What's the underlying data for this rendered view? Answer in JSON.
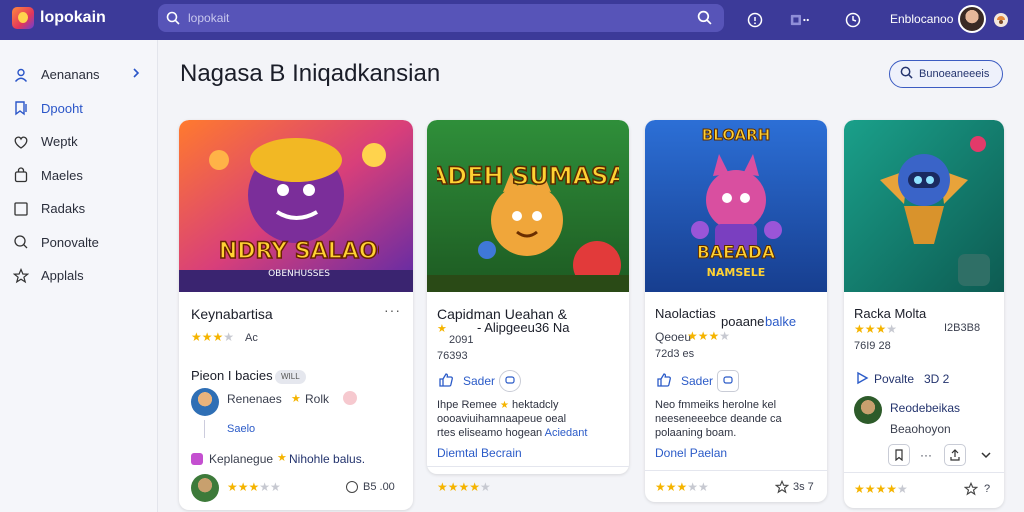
{
  "app": {
    "name": "lopokain"
  },
  "search": {
    "placeholder": "lopokait"
  },
  "user": {
    "name": "Enblocanoo"
  },
  "icons": [
    "search-icon",
    "help-icon",
    "apps-icon",
    "notifications-icon",
    "settings-icon"
  ],
  "sidebar": {
    "items": [
      {
        "label": "Aenanans",
        "icon": "person-icon"
      },
      {
        "label": "Dpooht",
        "icon": "bookmark-icon"
      },
      {
        "label": "Weptk",
        "icon": "heart-icon"
      },
      {
        "label": "Maeles",
        "icon": "bag-icon"
      },
      {
        "label": "Radaks",
        "icon": "square-icon"
      },
      {
        "label": "Ponovalte",
        "icon": "search-icon"
      },
      {
        "label": "Applals",
        "icon": "star-icon"
      }
    ]
  },
  "main": {
    "title": "Nagasa B Iniqadkansian",
    "filter_label": "Bunoeaneeeis"
  },
  "cards": [
    {
      "art_title": "AHNDRY SALAOON",
      "art_subtitle": "OBENHUSSES",
      "title": "Keynabartisa",
      "rating": 3,
      "rating_label": "Ac",
      "section_label": "Pieon I bacies",
      "section_badge": "WILL",
      "reviewer_name": "Renenaes",
      "reviewer_extra": "Rolk",
      "reviewer_sub": "Saelo",
      "tagline_a": "Keplanegue",
      "tagline_b": "Nihohle balus.",
      "footer_rating": 3,
      "footer_meta": "B5 .00"
    },
    {
      "art_title": "GADEH SUMASAN",
      "title": "Capidman Ueahan &",
      "subtitle": "- Alipgeeu36 Na",
      "rating": 2,
      "year_line_1": "2091",
      "year_line_2": "76393",
      "action_label": "Sader",
      "desc_1": "Ihpe Remee",
      "desc_1b": "hektadcly",
      "desc_2": "oooaviuihamnaapeue oeal",
      "desc_3": "rtes eliseamo hogean",
      "desc_3b": "Aciedant",
      "link": "Diemtal Becrain",
      "footer_rating": 4
    },
    {
      "art_title": "BLOARH",
      "art_sub_1": "BAEADA",
      "art_sub_2": "NAMSELE",
      "title": "Naolactias",
      "title_b": "poaane",
      "title_c": "balke",
      "subtitle": "Qeoeu",
      "rating": 3,
      "meta": "72d3 es",
      "action_label": "Sader",
      "desc_1": "Neo fmmeiks herolne kel",
      "desc_2": "neeseneeebce deande ca",
      "desc_3": "polaaning boam.",
      "link": "Donel Paelan",
      "footer_rating": 3,
      "footer_meta": "3s 7"
    },
    {
      "title": "Racka Molta",
      "rating": 3,
      "meta": "I2B3B8",
      "year_line": "76I9 28",
      "action_label": "Povalte",
      "action_value": "3D 2",
      "reviewer_name": "Reodebeikas",
      "reviewer_sub": "Beaohoyon",
      "footer_rating": 4
    }
  ],
  "colors": {
    "topbar": "#3c3a99",
    "accent": "#2b5bc8",
    "star": "#f5b400"
  }
}
